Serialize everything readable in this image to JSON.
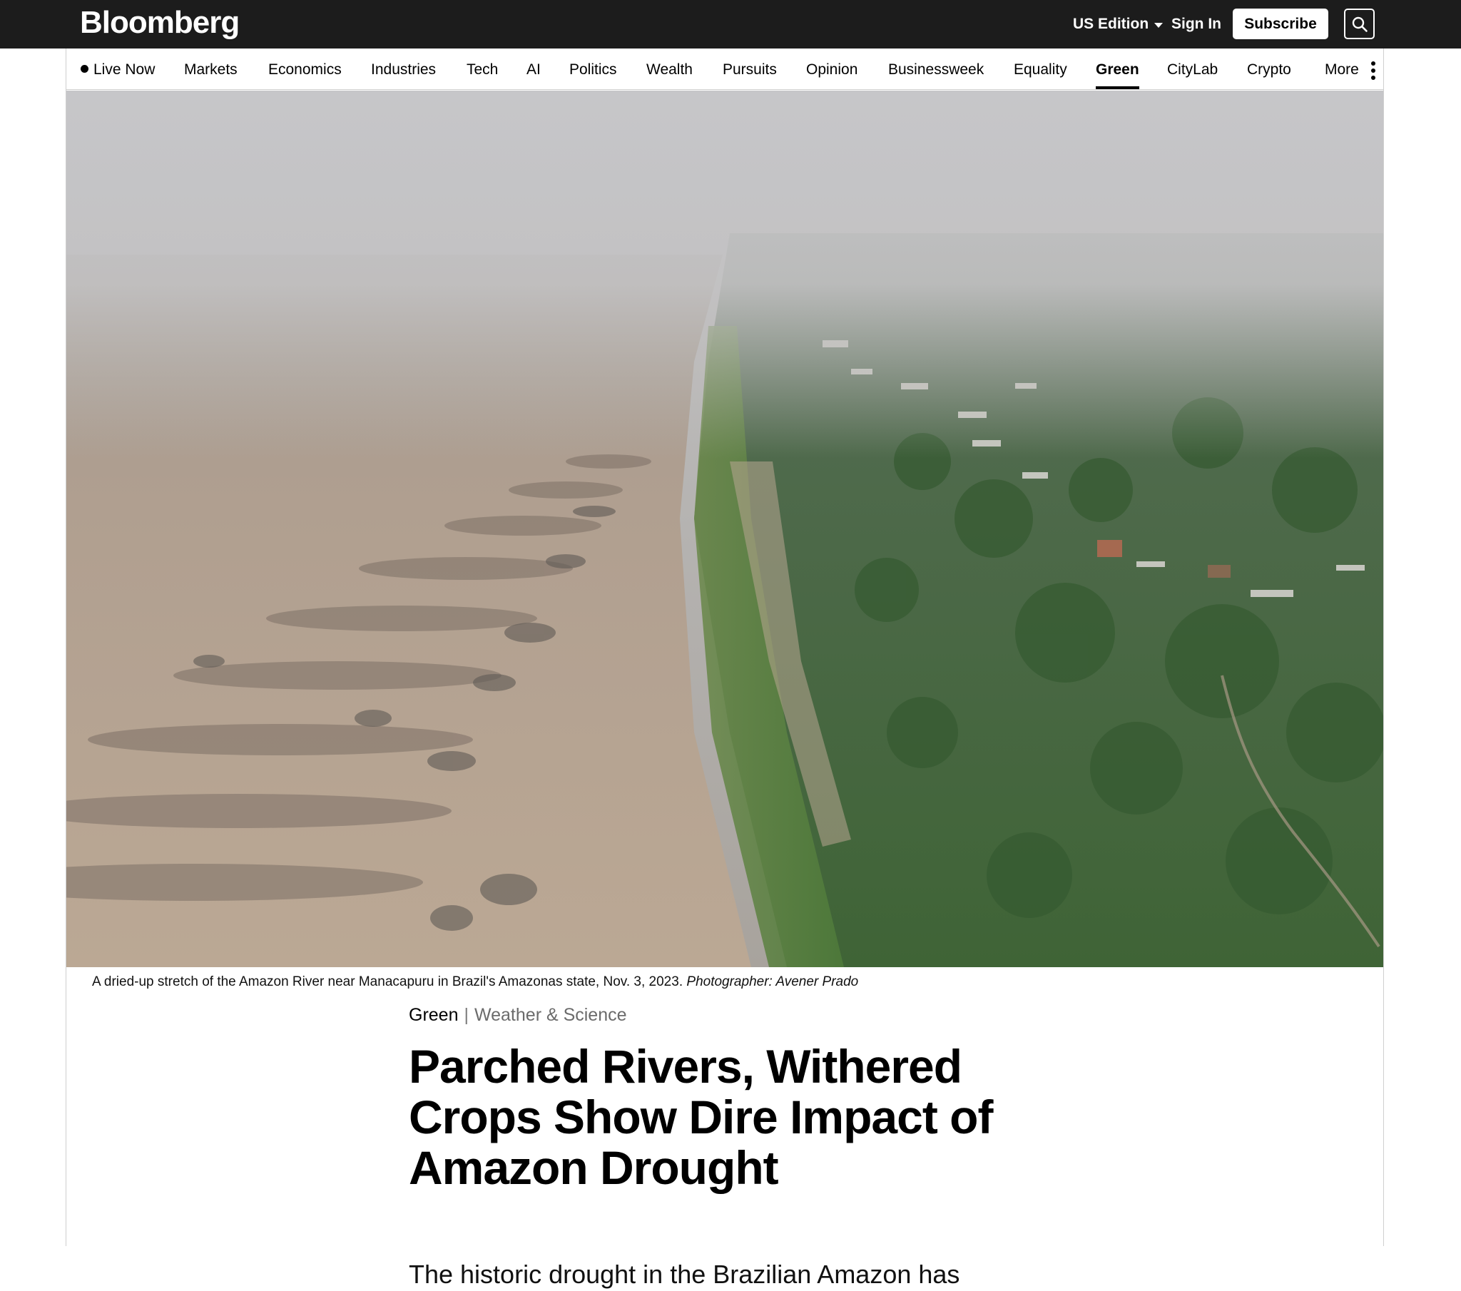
{
  "header": {
    "logo": "Bloomberg",
    "edition": "US Edition",
    "sign_in": "Sign In",
    "subscribe": "Subscribe",
    "search_icon": "search-icon"
  },
  "nav": {
    "items": [
      {
        "label": "Live Now"
      },
      {
        "label": "Markets"
      },
      {
        "label": "Economics"
      },
      {
        "label": "Industries"
      },
      {
        "label": "Tech"
      },
      {
        "label": "AI"
      },
      {
        "label": "Politics"
      },
      {
        "label": "Wealth"
      },
      {
        "label": "Pursuits"
      },
      {
        "label": "Opinion"
      },
      {
        "label": "Businessweek"
      },
      {
        "label": "Equality"
      },
      {
        "label": "Green"
      },
      {
        "label": "CityLab"
      },
      {
        "label": "Crypto"
      },
      {
        "label": "More"
      }
    ],
    "active": "Green"
  },
  "hero": {
    "caption": "A dried-up stretch of the Amazon River near Manacapuru in Brazil's Amazonas state, Nov. 3, 2023.",
    "credit": "Photographer: Avener Prado"
  },
  "article": {
    "section": "Green",
    "separator": "|",
    "subsection": "Weather & Science",
    "headline": "Parched Rivers, Withered Crops Show Dire Impact of Amazon Drought",
    "dek": "The historic drought in the Brazilian Amazon has"
  },
  "colors": {
    "topbar": "#1c1c1c",
    "text": "#000000",
    "muted": "#6b6b6b",
    "border": "#cfcfcf"
  }
}
